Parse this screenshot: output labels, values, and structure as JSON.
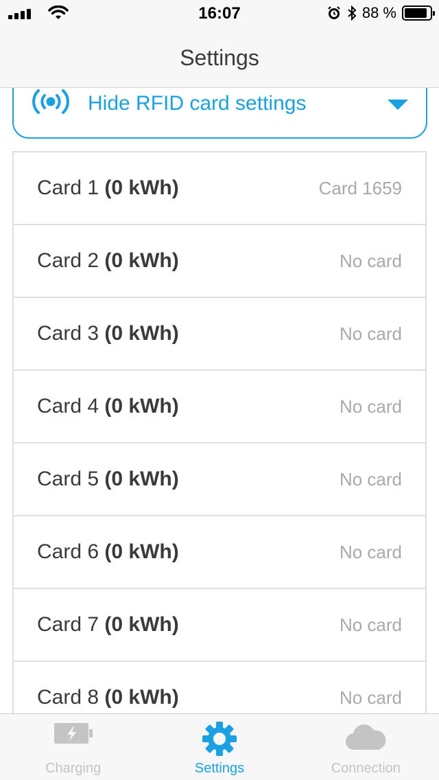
{
  "status_bar": {
    "time": "16:07",
    "battery_text": "88 %",
    "battery_level": 0.88
  },
  "nav": {
    "title": "Settings"
  },
  "rfid_toggle": {
    "label": "Hide RFID card settings",
    "icon": "rfid-icon",
    "color": "#1ba1e2"
  },
  "cards": [
    {
      "name": "Card 1",
      "energy": "(0 kWh)",
      "status": "Card 1659"
    },
    {
      "name": "Card 2",
      "energy": "(0 kWh)",
      "status": "No card"
    },
    {
      "name": "Card 3",
      "energy": "(0 kWh)",
      "status": "No card"
    },
    {
      "name": "Card 4",
      "energy": "(0 kWh)",
      "status": "No card"
    },
    {
      "name": "Card 5",
      "energy": "(0 kWh)",
      "status": "No card"
    },
    {
      "name": "Card 6",
      "energy": "(0 kWh)",
      "status": "No card"
    },
    {
      "name": "Card 7",
      "energy": "(0 kWh)",
      "status": "No card"
    },
    {
      "name": "Card 8",
      "energy": "(0 kWh)",
      "status": "No card"
    }
  ],
  "tabbar": {
    "tabs": [
      {
        "label": "Charging",
        "icon": "battery-charging-icon",
        "active": false
      },
      {
        "label": "Settings",
        "icon": "gear-icon",
        "active": true
      },
      {
        "label": "Connection",
        "icon": "cloud-icon",
        "active": false
      }
    ],
    "active_color": "#1ba1e2",
    "inactive_color": "#c4c4c4"
  }
}
